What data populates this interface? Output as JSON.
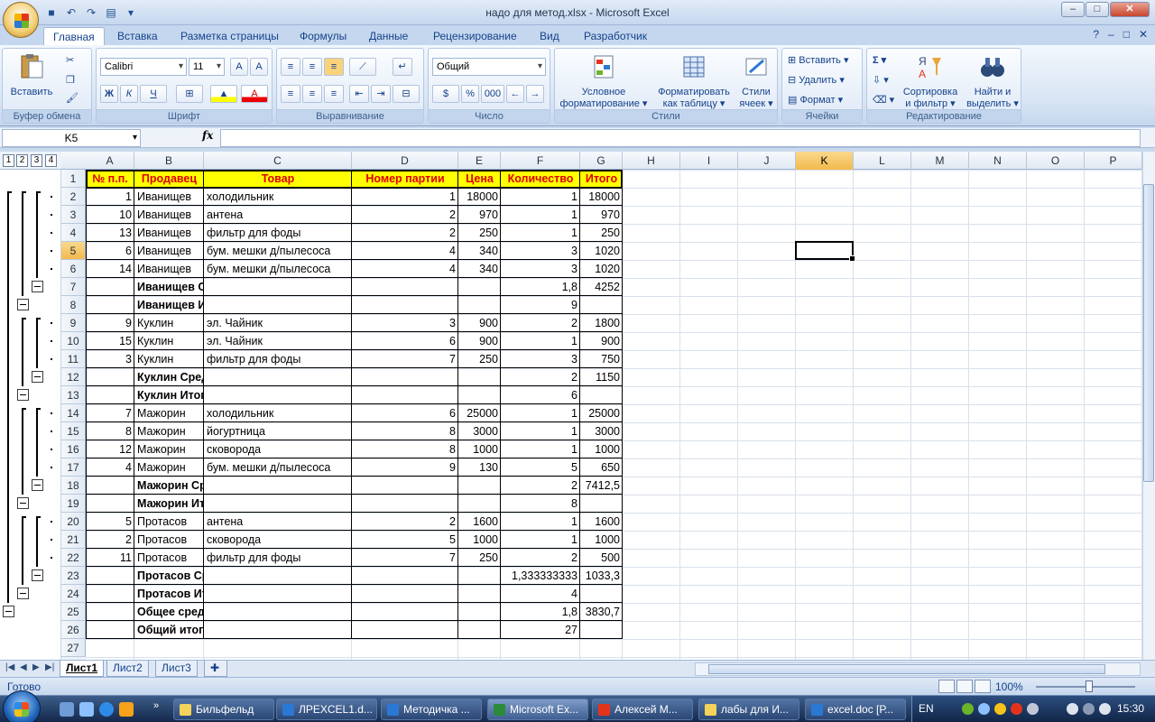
{
  "window": {
    "title": "надо для метод.xlsx - Microsoft Excel",
    "controls": [
      "–",
      "□",
      "✕"
    ]
  },
  "ribbon_tabs": [
    "Главная",
    "Вставка",
    "Разметка страницы",
    "Формулы",
    "Данные",
    "Рецензирование",
    "Вид",
    "Разработчик"
  ],
  "ribbon": {
    "clipboard": {
      "label": "Буфер обмена",
      "paste": "Вставить"
    },
    "font": {
      "label": "Шрифт",
      "name": "Calibri",
      "size": "11",
      "bold": "Ж",
      "italic": "К",
      "underline": "Ч"
    },
    "alignment": {
      "label": "Выравнивание"
    },
    "number": {
      "label": "Число",
      "format": "Общий",
      "percent": "%",
      "thousands": "000"
    },
    "styles": {
      "label": "Стили",
      "conditional": "Условное",
      "conditional2": "форматирование ▾",
      "as_table": "Форматировать",
      "as_table2": "как таблицу ▾",
      "cell_styles": "Стили",
      "cell_styles2": "ячеек ▾"
    },
    "cells": {
      "label": "Ячейки",
      "insert": "Вставить ▾",
      "delete": "Удалить ▾",
      "format": "Формат ▾"
    },
    "editing": {
      "label": "Редактирование",
      "sum": "Σ ▾",
      "sort": "Сортировка",
      "sort2": "и фильтр ▾",
      "find": "Найти и",
      "find2": "выделить ▾"
    }
  },
  "formula_bar": {
    "name_box": "K5",
    "fx": "fx",
    "value": ""
  },
  "outline": {
    "levels": [
      "1",
      "2",
      "3",
      "4"
    ]
  },
  "columns": [
    "A",
    "B",
    "C",
    "D",
    "E",
    "F",
    "G",
    "H",
    "I",
    "J",
    "K",
    "L",
    "M",
    "N",
    "O",
    "P"
  ],
  "selected_column": "K",
  "rows": [
    "1",
    "2",
    "3",
    "4",
    "5",
    "6",
    "7",
    "8",
    "9",
    "10",
    "11",
    "12",
    "13",
    "14",
    "15",
    "16",
    "17",
    "18",
    "19",
    "20",
    "21",
    "22",
    "23",
    "24",
    "25",
    "26",
    "27"
  ],
  "selected_row": "5",
  "header_row": [
    "№ п.п.",
    "Продавец",
    "Товар",
    "Номер партии",
    "Цена",
    "Количество",
    "Итого"
  ],
  "table": [
    [
      "1",
      "Иванищев",
      "холодильник",
      "1",
      "18000",
      "1",
      "18000"
    ],
    [
      "10",
      "Иванищев",
      "антена",
      "2",
      "970",
      "1",
      "970"
    ],
    [
      "13",
      "Иванищев",
      "фильтр для фоды",
      "2",
      "250",
      "1",
      "250"
    ],
    [
      "6",
      "Иванищев",
      "бум. мешки д/пылесоса",
      "4",
      "340",
      "3",
      "1020"
    ],
    [
      "14",
      "Иванищев",
      "бум. мешки д/пылесоса",
      "4",
      "340",
      "3",
      "1020"
    ],
    [
      "",
      "Иванищев Среднее",
      "",
      "",
      "",
      "1,8",
      "4252"
    ],
    [
      "",
      "Иванищев Итог",
      "",
      "",
      "",
      "9",
      ""
    ],
    [
      "9",
      "Куклин",
      "эл. Чайник",
      "3",
      "900",
      "2",
      "1800"
    ],
    [
      "15",
      "Куклин",
      "эл. Чайник",
      "6",
      "900",
      "1",
      "900"
    ],
    [
      "3",
      "Куклин",
      "фильтр для фоды",
      "7",
      "250",
      "3",
      "750"
    ],
    [
      "",
      "Куклин Среднее",
      "",
      "",
      "",
      "2",
      "1150"
    ],
    [
      "",
      "Куклин Итог",
      "",
      "",
      "",
      "6",
      ""
    ],
    [
      "7",
      "Мажорин",
      "холодильник",
      "6",
      "25000",
      "1",
      "25000"
    ],
    [
      "8",
      "Мажорин",
      "йогуртница",
      "8",
      "3000",
      "1",
      "3000"
    ],
    [
      "12",
      "Мажорин",
      "сковорода",
      "8",
      "1000",
      "1",
      "1000"
    ],
    [
      "4",
      "Мажорин",
      "бум. мешки д/пылесоса",
      "9",
      "130",
      "5",
      "650"
    ],
    [
      "",
      "Мажорин Среднее",
      "",
      "",
      "",
      "2",
      "7412,5"
    ],
    [
      "",
      "Мажорин Итог",
      "",
      "",
      "",
      "8",
      ""
    ],
    [
      "5",
      "Протасов",
      "антена",
      "2",
      "1600",
      "1",
      "1600"
    ],
    [
      "2",
      "Протасов",
      "сковорода",
      "5",
      "1000",
      "1",
      "1000"
    ],
    [
      "11",
      "Протасов",
      "фильтр для фоды",
      "7",
      "250",
      "2",
      "500"
    ],
    [
      "",
      "Протасов Среднее",
      "",
      "",
      "",
      "1,333333333",
      "1033,3"
    ],
    [
      "",
      "Протасов Итог",
      "",
      "",
      "",
      "4",
      ""
    ],
    [
      "",
      "Общее среднее",
      "",
      "",
      "",
      "1,8",
      "3830,7"
    ],
    [
      "",
      "Общий итог",
      "",
      "",
      "",
      "27",
      ""
    ]
  ],
  "sheets": [
    "Лист1",
    "Лист2",
    "Лист3"
  ],
  "active_sheet": "Лист1",
  "status": {
    "text": "Готово",
    "zoom": "100%"
  },
  "taskbar": {
    "items": [
      "Бильфельд",
      "ЛРEXCEL1.d...",
      "Методичка ...",
      "Microsoft Ex...",
      "Алексей М...",
      "лабы для И...",
      "excel.doc [Р..."
    ],
    "active": "Microsoft Ex...",
    "lang": "EN",
    "clock": "15:30",
    "more": "»"
  }
}
